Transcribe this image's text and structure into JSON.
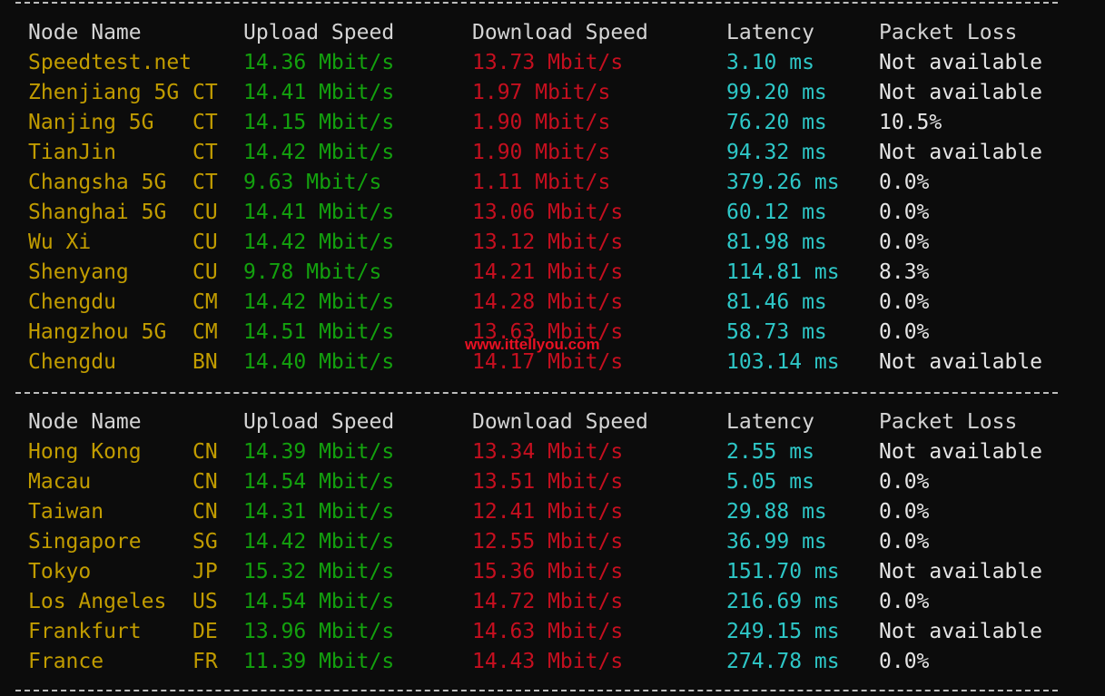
{
  "headers": {
    "node_name": "Node Name",
    "upload": "Upload Speed",
    "download": "Download Speed",
    "latency": "Latency",
    "loss": "Packet Loss"
  },
  "domestic": [
    {
      "name": "Speedtest.net",
      "code": "",
      "up": "14.36 Mbit/s",
      "down": "13.73 Mbit/s",
      "lat": "3.10 ms",
      "loss": "Not available"
    },
    {
      "name": "Zhenjiang 5G",
      "code": "CT",
      "up": "14.41 Mbit/s",
      "down": "1.97 Mbit/s",
      "lat": "99.20 ms",
      "loss": "Not available"
    },
    {
      "name": "Nanjing 5G",
      "code": "CT",
      "up": "14.15 Mbit/s",
      "down": "1.90 Mbit/s",
      "lat": "76.20 ms",
      "loss": "10.5%"
    },
    {
      "name": "TianJin",
      "code": "CT",
      "up": "14.42 Mbit/s",
      "down": "1.90 Mbit/s",
      "lat": "94.32 ms",
      "loss": "Not available"
    },
    {
      "name": "Changsha 5G",
      "code": "CT",
      "up": "9.63 Mbit/s",
      "down": "1.11 Mbit/s",
      "lat": "379.26 ms",
      "loss": "0.0%"
    },
    {
      "name": "Shanghai 5G",
      "code": "CU",
      "up": "14.41 Mbit/s",
      "down": "13.06 Mbit/s",
      "lat": "60.12 ms",
      "loss": "0.0%"
    },
    {
      "name": "Wu Xi",
      "code": "CU",
      "up": "14.42 Mbit/s",
      "down": "13.12 Mbit/s",
      "lat": "81.98 ms",
      "loss": "0.0%"
    },
    {
      "name": "Shenyang",
      "code": "CU",
      "up": "9.78 Mbit/s",
      "down": "14.21 Mbit/s",
      "lat": "114.81 ms",
      "loss": "8.3%"
    },
    {
      "name": "Chengdu",
      "code": "CM",
      "up": "14.42 Mbit/s",
      "down": "14.28 Mbit/s",
      "lat": "81.46 ms",
      "loss": "0.0%"
    },
    {
      "name": "Hangzhou 5G",
      "code": "CM",
      "up": "14.51 Mbit/s",
      "down": "13.63 Mbit/s",
      "lat": "58.73 ms",
      "loss": "0.0%"
    },
    {
      "name": "Chengdu",
      "code": "BN",
      "up": "14.40 Mbit/s",
      "down": "14.17 Mbit/s",
      "lat": "103.14 ms",
      "loss": "Not available"
    }
  ],
  "international": [
    {
      "name": "Hong Kong",
      "code": "CN",
      "up": "14.39 Mbit/s",
      "down": "13.34 Mbit/s",
      "lat": "2.55 ms",
      "loss": "Not available"
    },
    {
      "name": "Macau",
      "code": "CN",
      "up": "14.54 Mbit/s",
      "down": "13.51 Mbit/s",
      "lat": "5.05 ms",
      "loss": "0.0%"
    },
    {
      "name": "Taiwan",
      "code": "CN",
      "up": "14.31 Mbit/s",
      "down": "12.41 Mbit/s",
      "lat": "29.88 ms",
      "loss": "0.0%"
    },
    {
      "name": "Singapore",
      "code": "SG",
      "up": "14.42 Mbit/s",
      "down": "12.55 Mbit/s",
      "lat": "36.99 ms",
      "loss": "0.0%"
    },
    {
      "name": "Tokyo",
      "code": "JP",
      "up": "15.32 Mbit/s",
      "down": "15.36 Mbit/s",
      "lat": "151.70 ms",
      "loss": "Not available"
    },
    {
      "name": "Los Angeles",
      "code": "US",
      "up": "14.54 Mbit/s",
      "down": "14.72 Mbit/s",
      "lat": "216.69 ms",
      "loss": "0.0%"
    },
    {
      "name": "Frankfurt",
      "code": "DE",
      "up": "13.96 Mbit/s",
      "down": "14.63 Mbit/s",
      "lat": "249.15 ms",
      "loss": "Not available"
    },
    {
      "name": "France",
      "code": "FR",
      "up": "11.39 Mbit/s",
      "down": "14.43 Mbit/s",
      "lat": "274.78 ms",
      "loss": "0.0%"
    }
  ],
  "watermark": "www.ittellyou.com",
  "colors": {
    "background": "#0c0c0c",
    "name": "#c19c00",
    "upload": "#13a10e",
    "download": "#c50f1f",
    "latency": "#2ec7c7",
    "loss": "#e5e5e5"
  }
}
